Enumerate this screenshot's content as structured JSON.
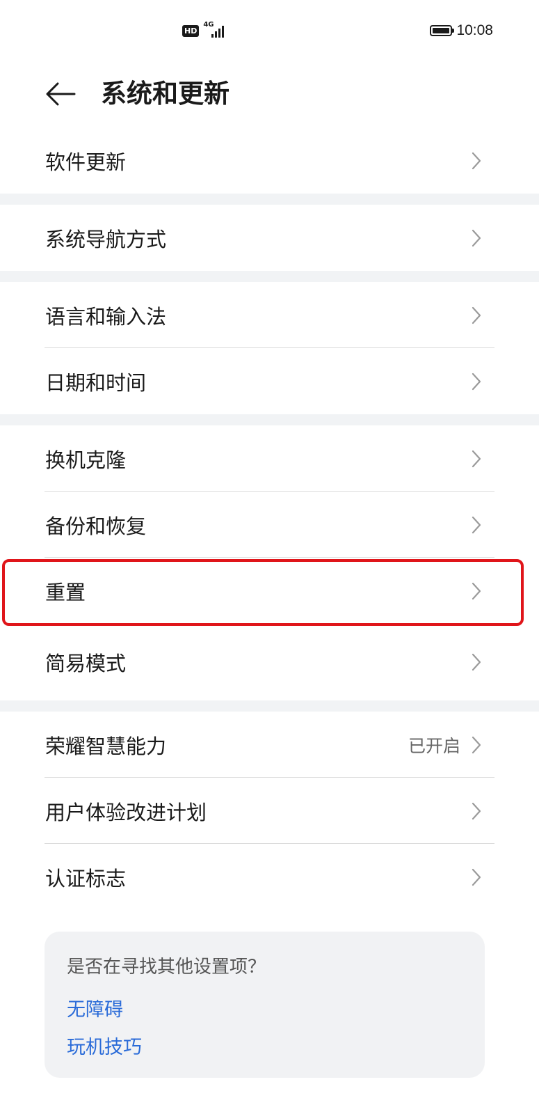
{
  "status_bar": {
    "hd_badge": "HD",
    "network_type": "4G",
    "time": "10:08",
    "icons": [
      "hd-icon",
      "signal-icon",
      "battery-icon"
    ]
  },
  "header": {
    "title": "系统和更新",
    "back_icon": "back-arrow-icon"
  },
  "groups": [
    {
      "items": [
        {
          "label": "软件更新"
        }
      ]
    },
    {
      "items": [
        {
          "label": "系统导航方式"
        }
      ]
    },
    {
      "items": [
        {
          "label": "语言和输入法"
        },
        {
          "label": "日期和时间"
        }
      ]
    },
    {
      "items": [
        {
          "label": "换机克隆"
        },
        {
          "label": "备份和恢复"
        },
        {
          "label": "重置",
          "highlighted": true
        },
        {
          "label": "简易模式"
        }
      ]
    },
    {
      "items": [
        {
          "label": "荣耀智慧能力",
          "value": "已开启"
        },
        {
          "label": "用户体验改进计划"
        },
        {
          "label": "认证标志"
        }
      ]
    }
  ],
  "suggestions": {
    "question": "是否在寻找其他设置项？",
    "links": [
      "无障碍",
      "玩机技巧"
    ]
  },
  "colors": {
    "highlight_border": "#e0151a",
    "link": "#2a6bd8",
    "separator_bg": "#f1f3f5"
  }
}
